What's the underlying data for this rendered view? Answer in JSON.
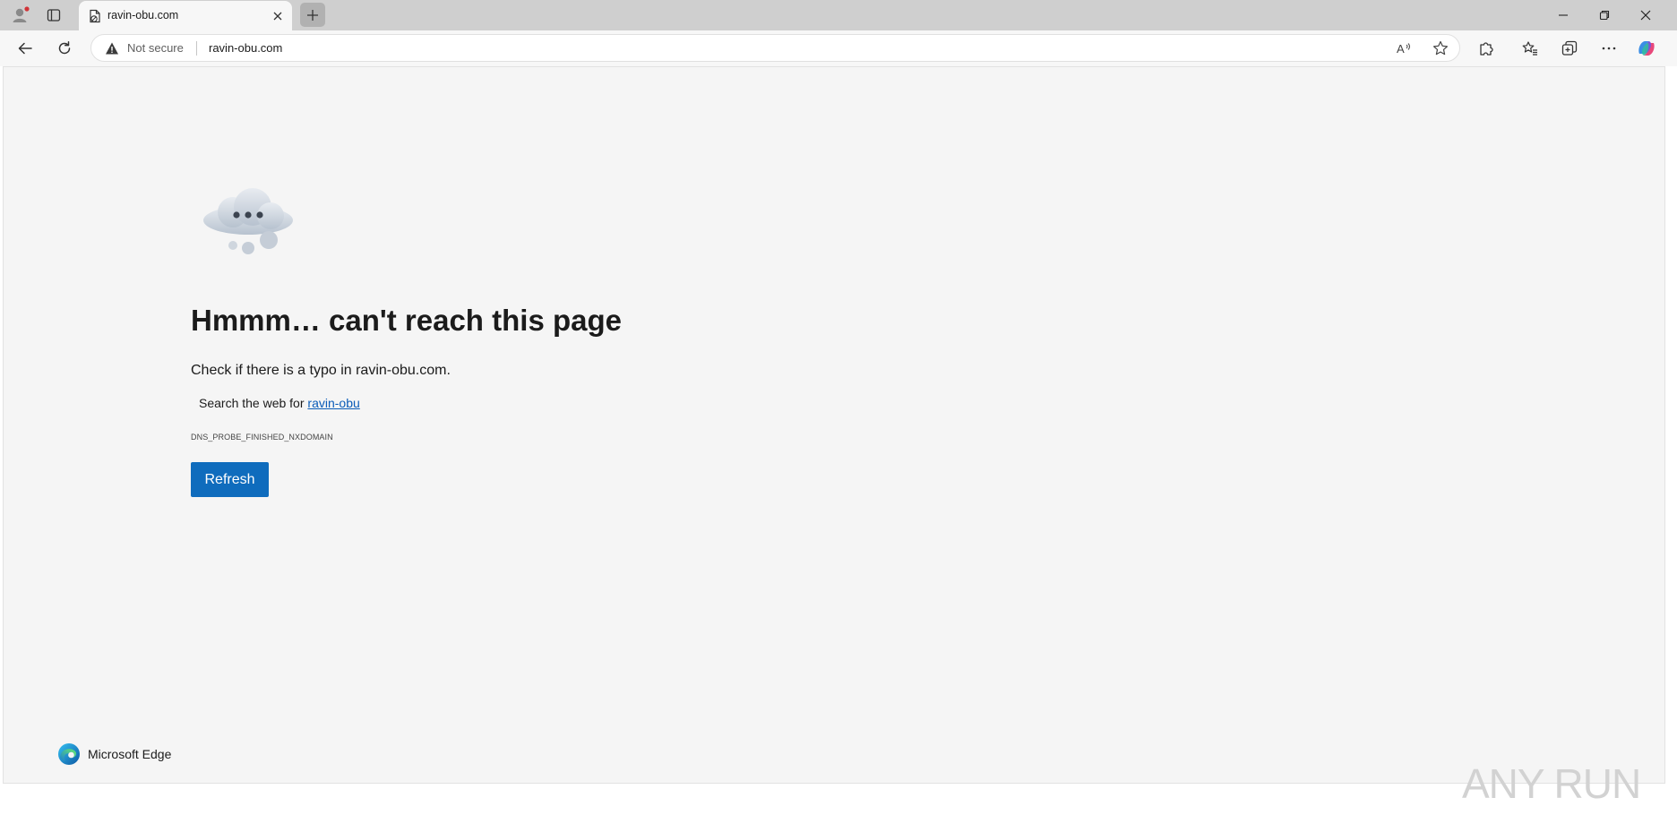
{
  "browser": {
    "tab": {
      "title": "ravin-obu.com"
    },
    "address_bar": {
      "security_label": "Not secure",
      "url": "ravin-obu.com"
    },
    "toolbar_icons": [
      "back-icon",
      "refresh-icon",
      "read-aloud-icon",
      "favorite-star-icon",
      "extensions-icon",
      "favorites-icon",
      "collections-icon",
      "more-icon",
      "copilot-icon"
    ],
    "window_controls": [
      "minimize-icon",
      "restore-icon",
      "close-icon"
    ]
  },
  "error_page": {
    "heading": "Hmmm… can't reach this page",
    "subheading": "Check if there is a typo in ravin-obu.com.",
    "search_prefix": "Search the web for ",
    "search_link": "ravin-obu",
    "error_code": "DNS_PROBE_FINISHED_NXDOMAIN",
    "refresh_label": "Refresh",
    "brand_label": "Microsoft Edge"
  },
  "watermark": {
    "text": "ANY RUN"
  },
  "colors": {
    "accent": "#0f6cbd",
    "link": "#0b5cb8",
    "page_background": "#f5f5f5",
    "tab_strip": "#cfcfcf"
  }
}
